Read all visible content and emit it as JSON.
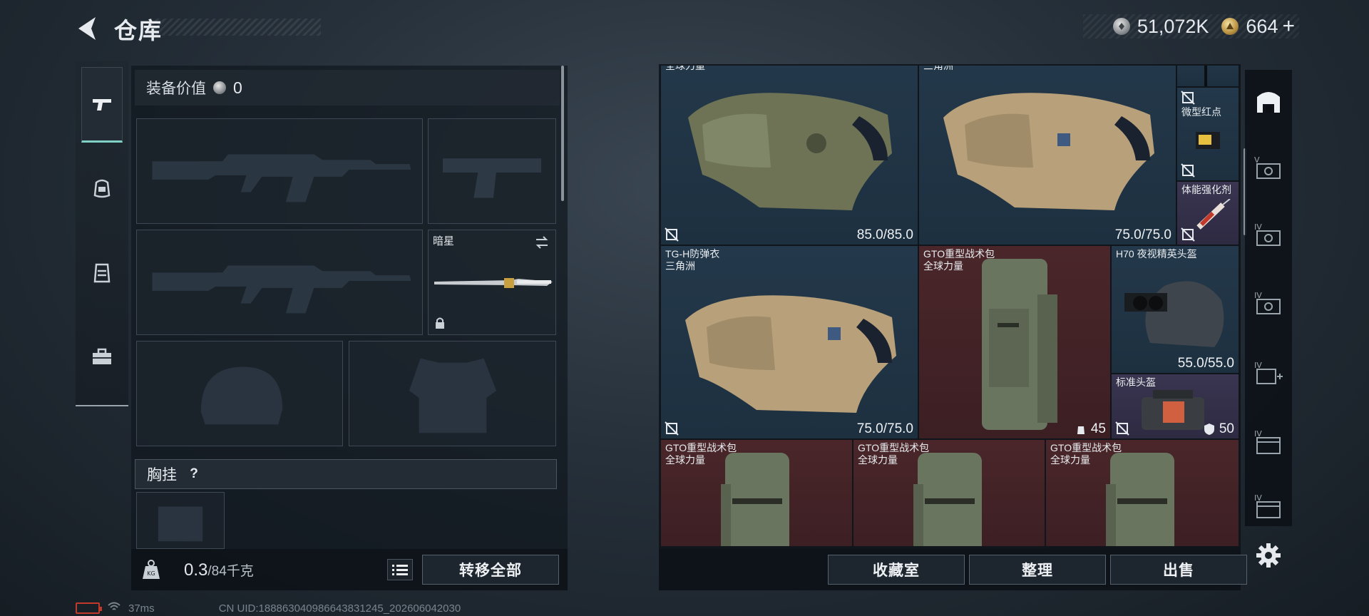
{
  "header": {
    "title": "仓库",
    "currencies": [
      {
        "icon": "silver-coin-icon",
        "value": "51,072K"
      },
      {
        "icon": "gold-coin-icon",
        "value": "664"
      }
    ],
    "plus": "+"
  },
  "left_rail": {
    "items": [
      {
        "icon": "pistol-icon",
        "active": true
      },
      {
        "icon": "helmet-icon",
        "active": false
      },
      {
        "icon": "vest-icon",
        "active": false
      },
      {
        "icon": "toolbox-icon",
        "active": false
      }
    ]
  },
  "equipment": {
    "value_label": "装备价值",
    "value": "0",
    "melee_slot": {
      "name": "暗星"
    },
    "chest_rig_label": "胸挂",
    "help": "?"
  },
  "footer_left": {
    "weight_value": "0.3",
    "weight_max": "/84千克",
    "transfer_all": "转移全部"
  },
  "storage": {
    "items": [
      {
        "name": "全球力量",
        "subtitle": "",
        "value": "85.0/85.0",
        "color": "blue"
      },
      {
        "name": "三角洲",
        "subtitle": "",
        "value": "75.0/75.0",
        "color": "blue"
      },
      {
        "name": "",
        "subtitle": "",
        "value": "",
        "color": "blue"
      },
      {
        "name": "微型红点",
        "subtitle": "",
        "value": "",
        "color": "blue"
      },
      {
        "name": "体能强化剂",
        "subtitle": "",
        "value": "",
        "color": "purple"
      },
      {
        "name": "TG-H防弹衣",
        "subtitle": "三角洲",
        "value": "75.0/75.0",
        "color": "blue"
      },
      {
        "name": "GTO重型战术包",
        "subtitle": "全球力量",
        "value": "45",
        "color": "red"
      },
      {
        "name": "H70 夜视精英头盔",
        "subtitle": "",
        "value": "55.0/55.0",
        "color": "blue"
      },
      {
        "name": "标准头盔",
        "subtitle": "",
        "value": "50",
        "color": "purple"
      },
      {
        "name": "GTO重型战术包",
        "subtitle": "全球力量",
        "value": "",
        "color": "red"
      },
      {
        "name": "GTO重型战术包",
        "subtitle": "全球力量",
        "value": "",
        "color": "red"
      },
      {
        "name": "GTO重型战术包",
        "subtitle": "全球力量",
        "value": "",
        "color": "red"
      }
    ]
  },
  "footer_right": {
    "collection": "收藏室",
    "sort": "整理",
    "sell": "出售"
  },
  "right_rail": {
    "items": [
      {
        "icon": "warehouse-icon",
        "label": ""
      },
      {
        "icon": "storage-v-icon",
        "label": "V"
      },
      {
        "icon": "storage-iv-icon",
        "label": "IV"
      },
      {
        "icon": "storage-iv-icon",
        "label": "IV"
      },
      {
        "icon": "storage-add-icon",
        "label": "IV"
      },
      {
        "icon": "storage-case-icon",
        "label": "IV"
      },
      {
        "icon": "storage-case-icon",
        "label": "IV"
      }
    ]
  },
  "status_bar": {
    "ping": "37ms",
    "uid": "CN UID:18886304098664383124­5_202606042030"
  },
  "colors": {
    "accent": "#7fd0c5",
    "cell_blue": "#23384a",
    "cell_red": "#4a262a",
    "cell_purple": "#3a3550"
  }
}
